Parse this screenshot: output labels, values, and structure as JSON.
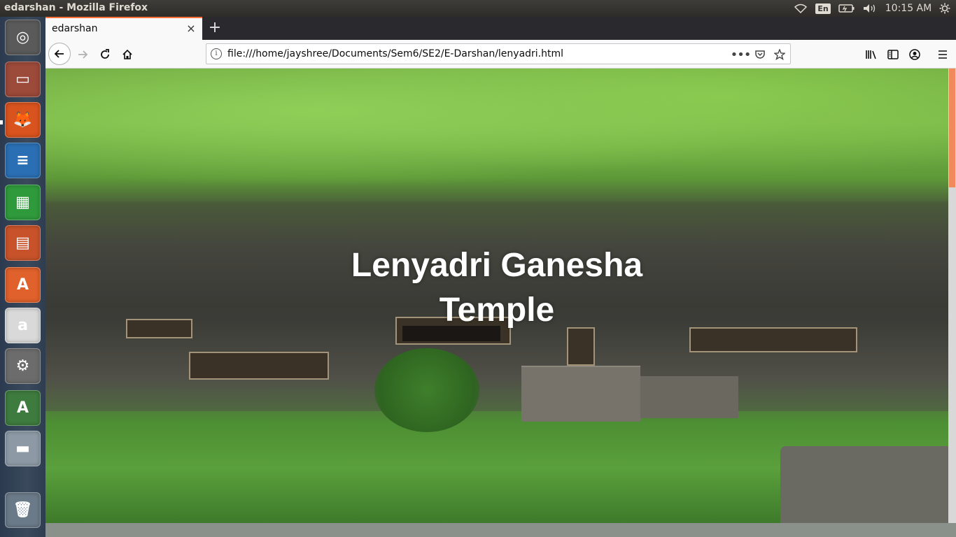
{
  "window": {
    "title": "edarshan - Mozilla Firefox"
  },
  "tray": {
    "keyboard": "En",
    "clock": "10:15 AM"
  },
  "launcher": {
    "items": [
      {
        "name": "dash-home",
        "glyph": "◎",
        "color": "#5a5a5a"
      },
      {
        "name": "files",
        "glyph": "▭",
        "color": "#9c4a3a"
      },
      {
        "name": "firefox",
        "glyph": "🦊",
        "color": "#d9531e"
      },
      {
        "name": "libreoffice-writer",
        "glyph": "≡",
        "color": "#2a6fb3"
      },
      {
        "name": "libreoffice-calc",
        "glyph": "▦",
        "color": "#2f9a3c"
      },
      {
        "name": "libreoffice-impress",
        "glyph": "▤",
        "color": "#c8532a"
      },
      {
        "name": "ubuntu-software",
        "glyph": "A",
        "color": "#e0612b"
      },
      {
        "name": "amazon",
        "glyph": "a",
        "color": "#d9d9d9"
      },
      {
        "name": "system-settings",
        "glyph": "⚙",
        "color": "#6c6c6c"
      },
      {
        "name": "software-updater",
        "glyph": "A",
        "color": "#3e7b3e"
      },
      {
        "name": "disk",
        "glyph": "▬",
        "color": "#8d9aa6"
      },
      {
        "name": "trash",
        "glyph": "🗑",
        "color": "#6b7a88"
      }
    ]
  },
  "browser": {
    "tab": {
      "title": "edarshan",
      "close": "×"
    },
    "new_tab": "+",
    "url": "file:///home/jayshree/Documents/Sem6/SE2/E-Darshan/lenyadri.html",
    "page_actions": "•••"
  },
  "page": {
    "hero_title": "Lenyadri Ganesha Temple"
  }
}
